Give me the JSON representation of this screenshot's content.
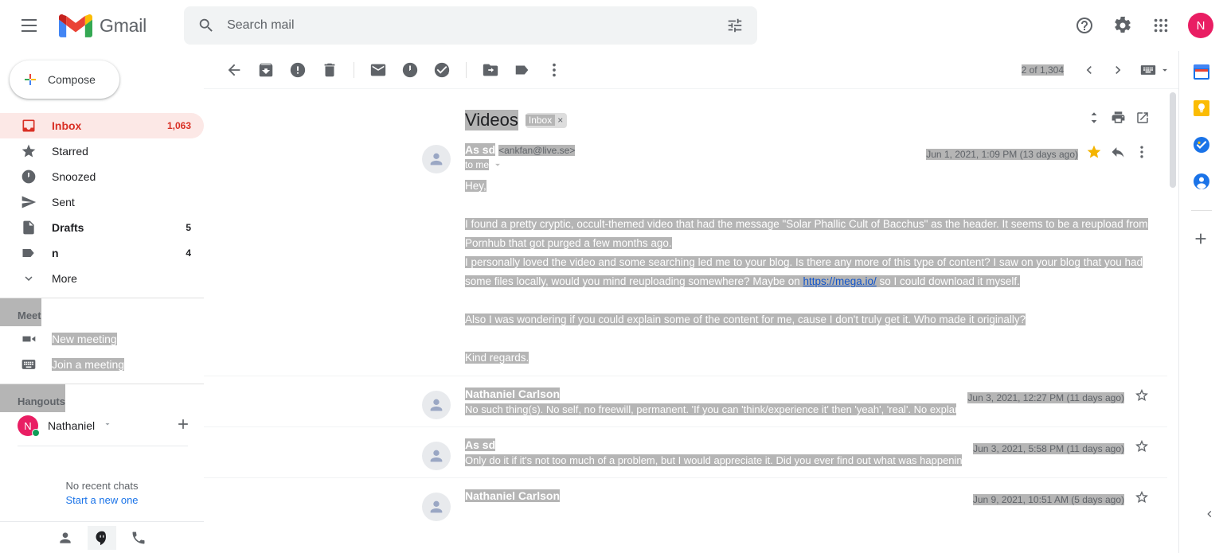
{
  "app": {
    "brand": "Gmail",
    "hamburger_label": "Main menu"
  },
  "search": {
    "placeholder": "Search mail",
    "value": "",
    "icon": "search-icon",
    "options_icon": "tune-icon"
  },
  "topbar": {
    "help_icon": "help-icon",
    "settings_icon": "gear-icon",
    "apps_icon": "apps-grid-icon",
    "account_initial": "N",
    "account_color": "#e91e63"
  },
  "compose": {
    "label": "Compose",
    "icon": "plus-icon"
  },
  "sidebar": {
    "items": [
      {
        "label": "Inbox",
        "count": "1,063",
        "icon": "inbox-icon",
        "active": true,
        "bold": true
      },
      {
        "label": "Starred",
        "count": "",
        "icon": "star-icon",
        "active": false,
        "bold": false
      },
      {
        "label": "Snoozed",
        "count": "",
        "icon": "clock-icon",
        "active": false,
        "bold": false
      },
      {
        "label": "Sent",
        "count": "",
        "icon": "send-icon",
        "active": false,
        "bold": false
      },
      {
        "label": "Drafts",
        "count": "5",
        "icon": "draft-icon",
        "active": false,
        "bold": true
      },
      {
        "label": "n",
        "count": "4",
        "icon": "label-icon",
        "active": false,
        "bold": true
      },
      {
        "label": "More",
        "count": "",
        "icon": "chevron-down-icon",
        "active": false,
        "bold": false
      }
    ],
    "meet": {
      "title": "Meet",
      "new_meeting": "New meeting",
      "join_meeting": "Join a meeting",
      "new_meeting_icon": "video-camera-icon",
      "join_meeting_icon": "keyboard-icon"
    },
    "hangouts": {
      "title": "Hangouts",
      "user_name": "Nathaniel",
      "user_initial": "N",
      "status_color": "#0f9d58",
      "empty_text": "No recent chats",
      "start_link": "Start a new one",
      "tabs": [
        "contacts-icon",
        "hangouts-icon",
        "phone-icon"
      ]
    }
  },
  "toolbar": {
    "back_icon": "back-arrow-icon",
    "archive_icon": "archive-icon",
    "spam_icon": "report-spam-icon",
    "delete_icon": "trash-icon",
    "unread_icon": "mark-unread-icon",
    "snooze_icon": "snooze-clock-icon",
    "task_icon": "add-to-tasks-icon",
    "move_icon": "move-to-folder-icon",
    "label_icon": "labels-icon",
    "more_icon": "more-vertical-icon",
    "page_count": "2 of 1,304",
    "prev_icon": "chevron-left-icon",
    "next_icon": "chevron-right-icon",
    "input_tools_icon": "keyboard-icon",
    "input_tools_caret": "caret-down-icon"
  },
  "thread": {
    "subject": "Videos",
    "label_chip": "Inbox",
    "label_chip_remove": "×",
    "actions": {
      "expand_icon": "expand-all-icon",
      "print_icon": "print-icon",
      "popout_icon": "open-in-new-window-icon"
    },
    "messages": [
      {
        "expanded": true,
        "from": "As sd",
        "email": "<ankfan@live.se>",
        "to": "to me",
        "date": "Jun 1, 2021, 1:09 PM (13 days ago)",
        "starred": true,
        "star_color": "#f4b400",
        "reply_icon": "reply-icon",
        "more_icon": "more-vertical-icon",
        "body": {
          "greeting": "Hey,",
          "para1": "I found a pretty cryptic, occult-themed video that had the message \"Solar Phallic Cult of Bacchus\" as the header. It seems to be a reupload from Pornhub that got purged a few months ago.",
          "para2_before": "I personally loved the video and some searching led me to your blog. Is there any more of this type of content? I saw on your blog that you had some files locally, would you mind reuploading somewhere? Maybe on ",
          "para2_link": "https://mega.io/",
          "para2_after": " so I could download it myself.",
          "para3": "Also I was wondering if you could explain some of the content for me, cause I don't truly get it. Who made it originally?",
          "signoff": "Kind regards."
        }
      },
      {
        "expanded": false,
        "from": "Nathaniel Carlson",
        "snippet": "No such thing(s). No self, no freewill, permanent. 'If you can 'think/experience it' then 'yeah', 'real'. No explanations 'available'. There really isn't a reas",
        "date": "Jun 3, 2021, 12:27 PM (11 days ago)",
        "starred": false
      },
      {
        "expanded": false,
        "from": "As sd",
        "snippet": "Only do it if it's not too much of a problem, but I would appreciate it. Did you ever find out what was happening to you? Från: Nathaniel Carlson <noselfnofreew",
        "date": "Jun 3, 2021, 5:58 PM (11 days ago)",
        "starred": false
      },
      {
        "expanded": false,
        "from": "Nathaniel Carlson",
        "snippet": "",
        "date": "Jun 9, 2021, 10:51 AM (5 days ago)",
        "starred": false
      }
    ]
  },
  "rightrail": {
    "icons": [
      "calendar-icon",
      "keep-icon",
      "tasks-icon",
      "contacts-icon"
    ],
    "add_icon": "plus-icon",
    "expand_icon": "chevron-left-icon"
  }
}
